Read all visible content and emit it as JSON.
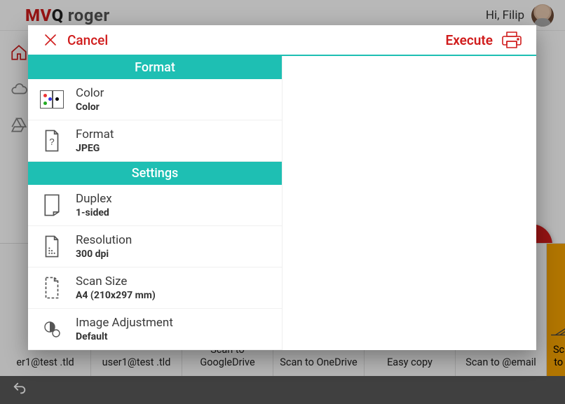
{
  "header": {
    "brand_prefix": "MV",
    "brand_suffix": "Q",
    "brand_word": "roger",
    "greeting": "Hi, Filip"
  },
  "modal": {
    "cancel": "Cancel",
    "execute": "Execute",
    "sections": {
      "format": "Format",
      "settings": "Settings"
    },
    "items": {
      "color": {
        "label": "Color",
        "value": "Color"
      },
      "format": {
        "label": "Format",
        "value": "JPEG"
      },
      "duplex": {
        "label": "Duplex",
        "value": "1-sided"
      },
      "resolution": {
        "label": "Resolution",
        "value": "300 dpi"
      },
      "scan_size": {
        "label": "Scan Size",
        "value": "A4 (210x297 mm)"
      },
      "image_adj": {
        "label": "Image Adjustment",
        "value": "Default"
      }
    }
  },
  "tiles": [
    {
      "label": "er1@test\n.tld"
    },
    {
      "label": "user1@test\n.tld"
    },
    {
      "label": "Scan to\nGoogleDrive"
    },
    {
      "label": "Scan to\nOneDrive"
    },
    {
      "label": "Easy copy"
    },
    {
      "label": "Scan to\n@email"
    },
    {
      "label": "Scan to @"
    }
  ]
}
